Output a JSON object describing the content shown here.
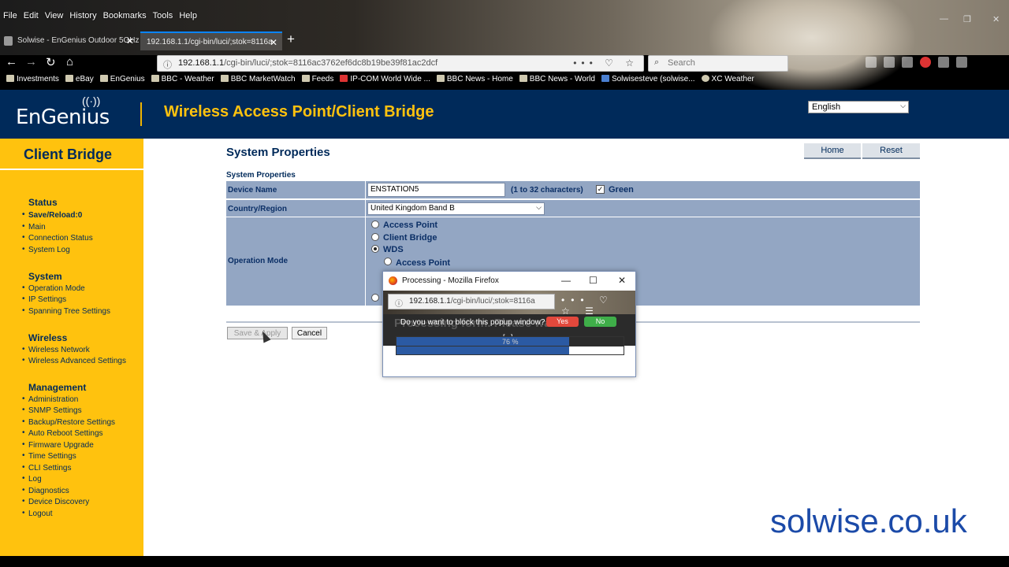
{
  "browser": {
    "menu": [
      "File",
      "Edit",
      "View",
      "History",
      "Bookmarks",
      "Tools",
      "Help"
    ],
    "window_controls": [
      "—",
      "❐",
      "✕"
    ],
    "tabs": [
      {
        "label": "Solwise - EnGenius Outdoor 5GHz",
        "close": "✕"
      },
      {
        "label": "192.168.1.1/cgi-bin/luci/;stok=8116a",
        "close": "✕"
      }
    ],
    "new_tab": "+",
    "url": {
      "host": "192.168.1.1",
      "path": "/cgi-bin/luci/;stok=8116ac3762ef6dc8b19be39f81ac2dcf"
    },
    "url_actions": "••• ♡ ☆",
    "search_placeholder": "Search",
    "bookmarks": [
      "Investments",
      "eBay",
      "EnGenius",
      "BBC - Weather",
      "BBC MarketWatch",
      "Feeds",
      "IP-COM World Wide ...",
      "BBC News - Home",
      "BBC News - World",
      "Solwisesteve (solwise...",
      "XC Weather"
    ]
  },
  "header": {
    "logo": "EnGenius",
    "title": "Wireless Access Point/Client Bridge",
    "language": "English"
  },
  "sidebar": {
    "title": "Client Bridge",
    "sections": [
      {
        "heading": "Status",
        "items": [
          "Save/Reload:0",
          "Main",
          "Connection Status",
          "System Log"
        ]
      },
      {
        "heading": "System",
        "items": [
          "Operation Mode",
          "IP Settings",
          "Spanning Tree Settings"
        ]
      },
      {
        "heading": "Wireless",
        "items": [
          "Wireless Network",
          "Wireless Advanced Settings"
        ]
      },
      {
        "heading": "Management",
        "items": [
          "Administration",
          "SNMP Settings",
          "Backup/Restore Settings",
          "Auto Reboot Settings",
          "Firmware Upgrade",
          "Time Settings",
          "CLI Settings",
          "Log",
          "Diagnostics",
          "Device Discovery",
          "Logout"
        ]
      }
    ]
  },
  "main": {
    "title": "System Properties",
    "home_button": "Home",
    "reset_button": "Reset",
    "subtitle": "System Properties",
    "device_name_label": "Device Name",
    "device_name_value": "ENSTATION5",
    "device_name_hint": "(1 to 32 characters)",
    "green_label": "Green",
    "green_checked": "✓",
    "country_label": "Country/Region",
    "country_value": "United Kingdom Band B",
    "operation_mode_label": "Operation Mode",
    "modes": [
      "Access Point",
      "Client Bridge",
      "WDS"
    ],
    "wds_sub": "Access Point",
    "save_button": "Save & Apply",
    "cancel_button": "Cancel"
  },
  "popup": {
    "title": "Processing - Mozilla Firefox",
    "url_host": "192.168.1.1",
    "url_path": "/cgi-bin/luci/;stok=8116a",
    "url_actions": "••• ♡ ☆ ☰",
    "bg_text": "Processing form. Please wait...",
    "block_question": "Do you want to block this popup window?",
    "yes": "Yes",
    "no": "No",
    "ellipsis": "[...]",
    "progress_percent": 76,
    "progress_label": "76 %",
    "window_controls": [
      "—",
      "☐",
      "✕"
    ]
  },
  "watermark": "solwise.co.uk"
}
